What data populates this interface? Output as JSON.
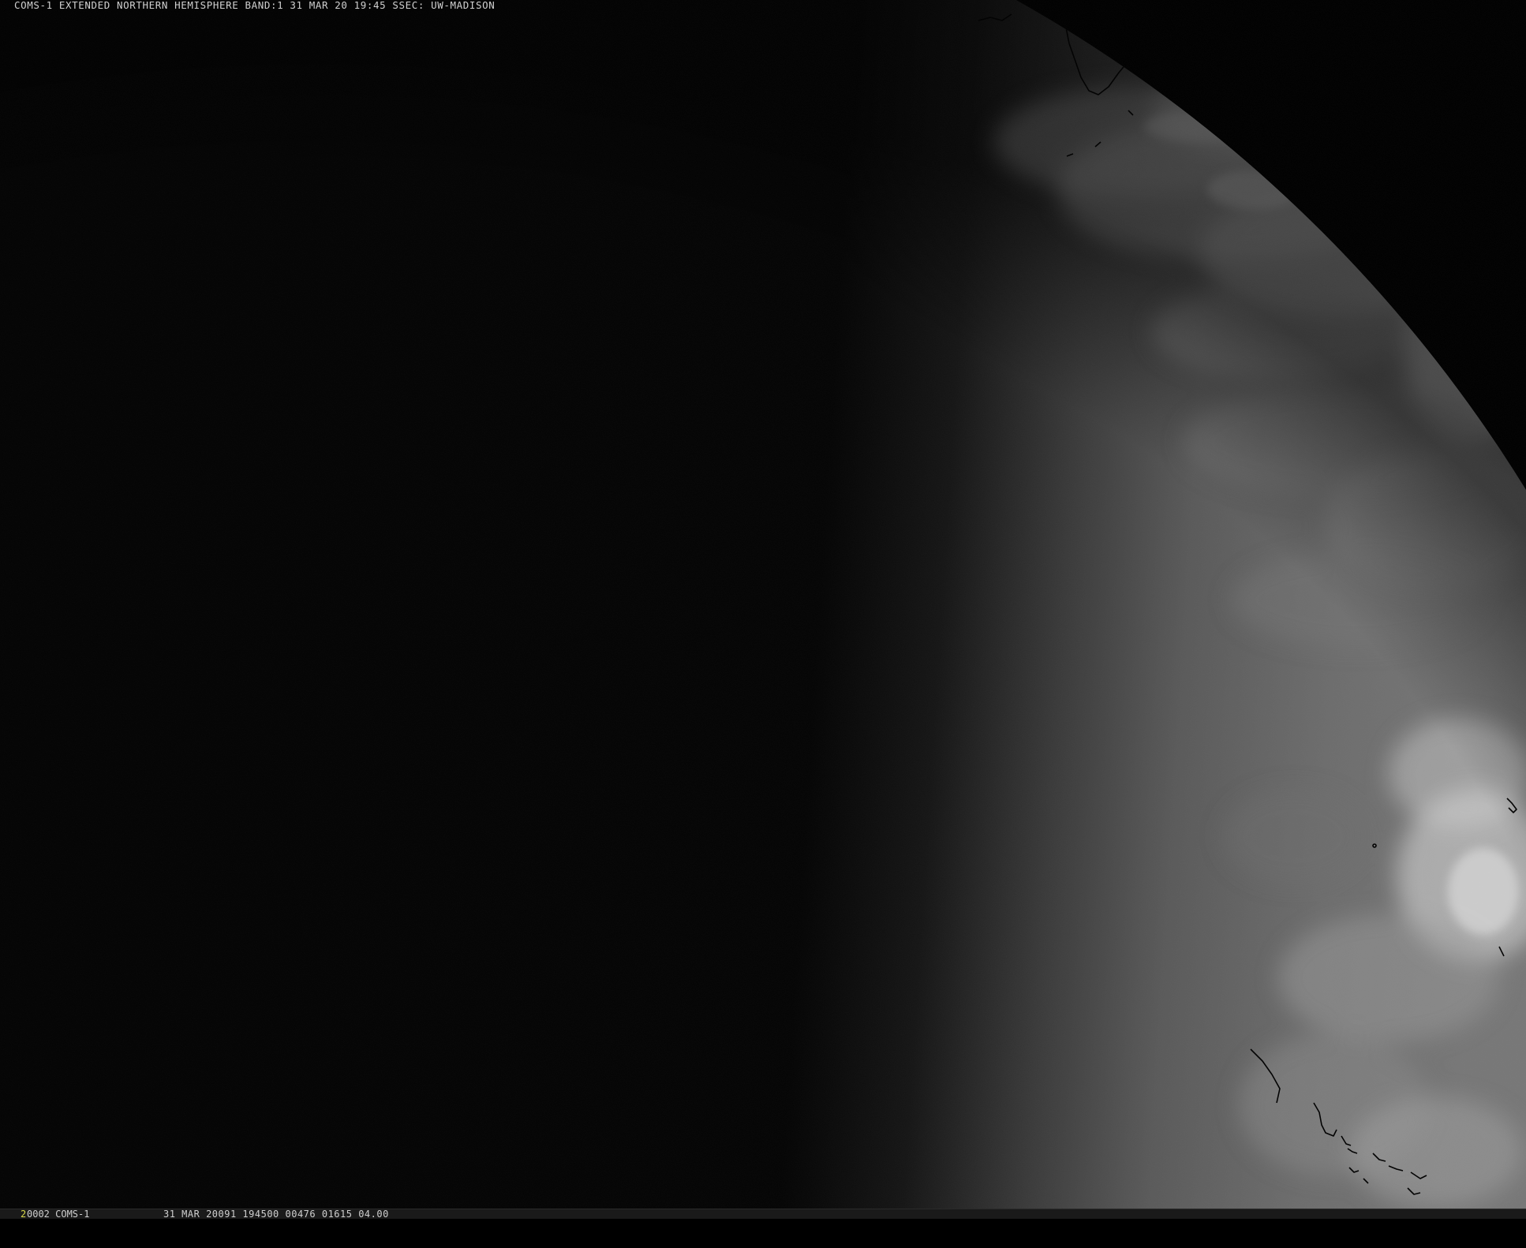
{
  "header": {
    "caption": "COMS-1 EXTENDED NORTHERN HEMISPHERE BAND:1 31 MAR 20 19:45 SSEC: UW-MADISON"
  },
  "statusbar": {
    "frame_number": "2",
    "frame_id": "0002 COMS-1",
    "frame_info": "31 MAR 20091 194500 00476 01615 04.00"
  },
  "image": {
    "subject": "satellite-earth-disk",
    "colors": {
      "space": "#000000",
      "night_side": "#050505",
      "day_side": "#6a6a6a",
      "clouds": "#d8d8d8",
      "coastline": "#000000",
      "status_bar": "#1a1a1a",
      "frame_number_color": "#d8d84a"
    }
  }
}
